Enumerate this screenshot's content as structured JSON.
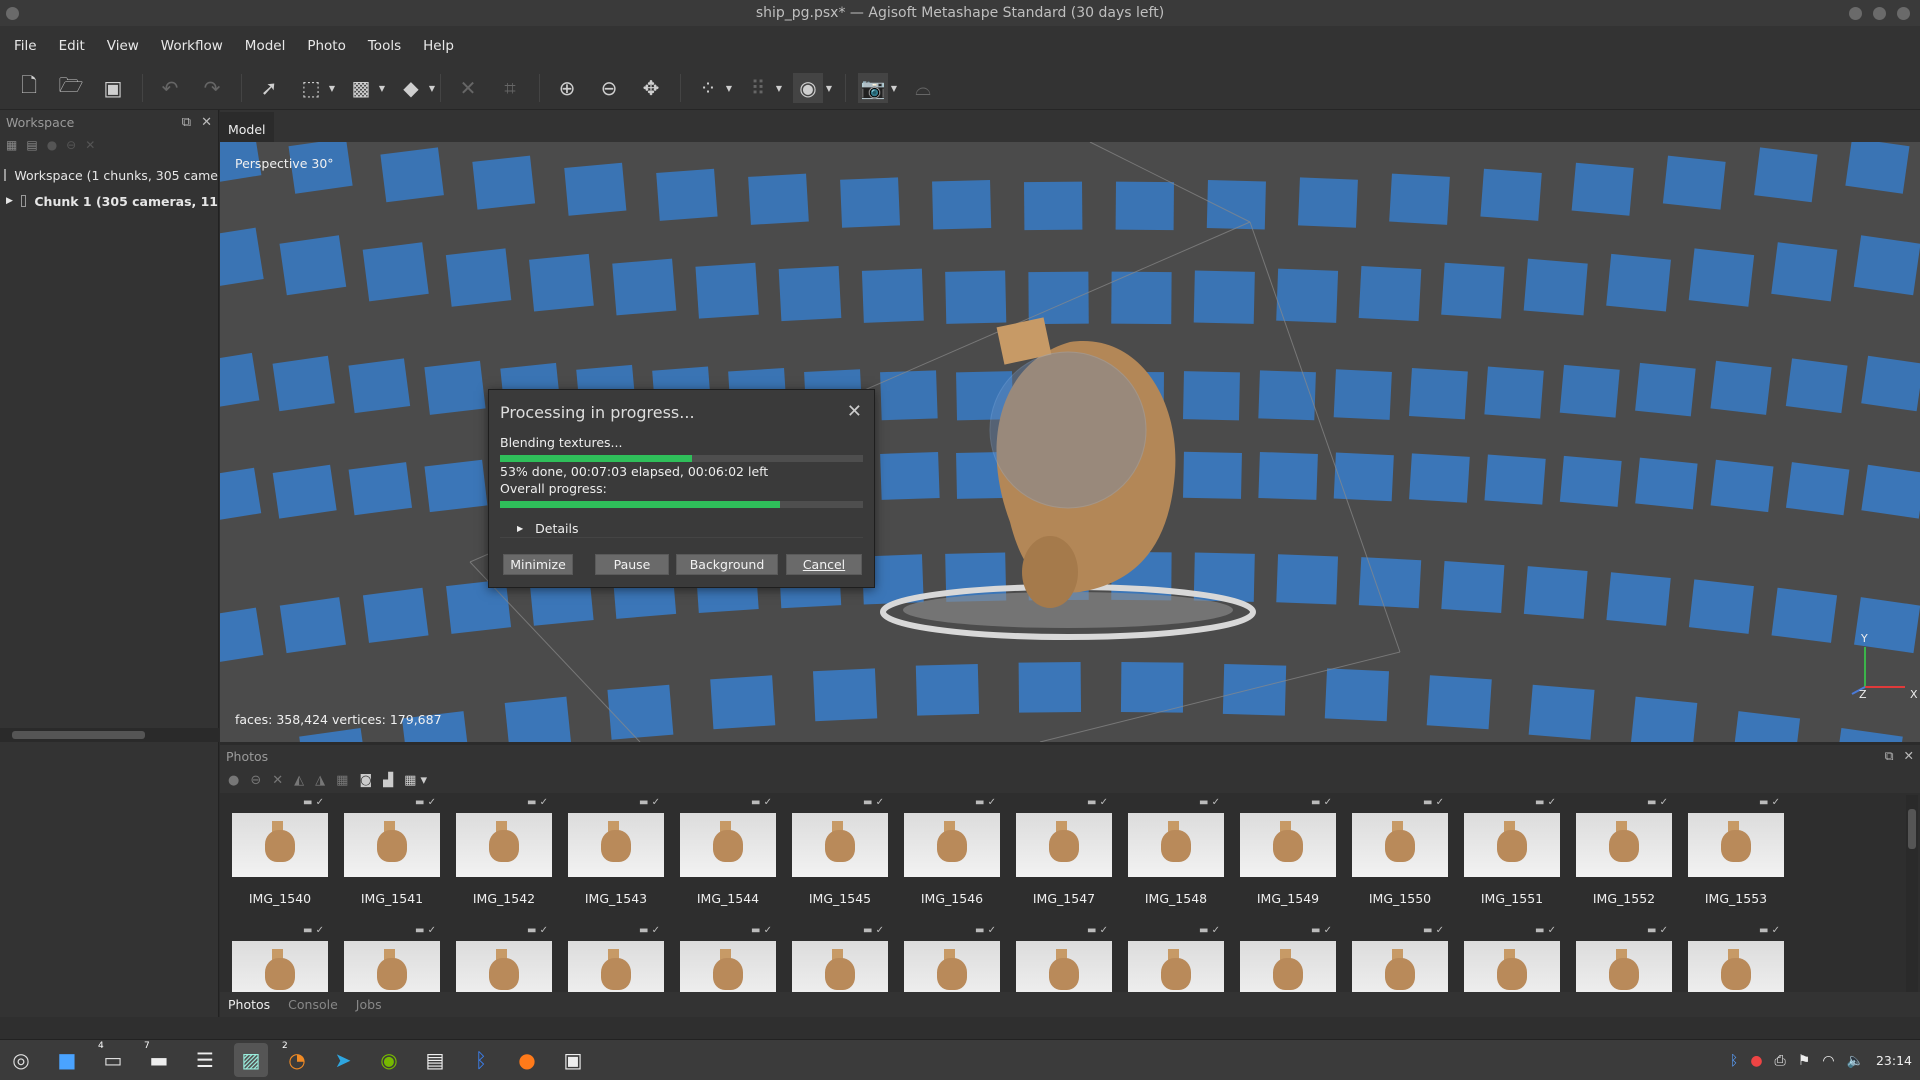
{
  "window": {
    "title": "ship_pg.psx* — Agisoft Metashape Standard (30 days left)"
  },
  "menu": [
    "File",
    "Edit",
    "View",
    "Workflow",
    "Model",
    "Photo",
    "Tools",
    "Help"
  ],
  "toolbar": {
    "icons": [
      "new-file-icon",
      "open-folder-icon",
      "save-icon",
      "undo-icon",
      "redo-icon",
      "select-arrow-icon",
      "rectangle-selection-icon",
      "free-form-selection-icon",
      "resize-region-icon",
      "delete-icon",
      "crop-icon",
      "zoom-in-icon",
      "zoom-out-icon",
      "reset-view-icon",
      "show-points-icon",
      "show-dense-cloud-icon",
      "shading-icon",
      "capture-view-icon",
      "show-cameras-icon"
    ]
  },
  "workspace": {
    "title": "Workspace",
    "items": [
      {
        "label": "Workspace (1 chunks, 305 came"
      },
      {
        "label": "Chunk 1 (305 cameras, 11"
      }
    ]
  },
  "viewport": {
    "tab": "Model",
    "projection": "Perspective 30°",
    "stats": "faces: 358,424 vertices: 179,687",
    "axes": {
      "y": "Y",
      "z": "Z",
      "x": "X"
    }
  },
  "dialog": {
    "title": "Processing in progress...",
    "task": "Blending textures...",
    "task_progress": 0.53,
    "status": "53% done, 00:07:03 elapsed, 00:06:02 left",
    "overall_label": "Overall progress:",
    "overall_progress": 0.77,
    "details": "Details",
    "buttons": {
      "minimize": "Minimize",
      "pause": "Pause",
      "background": "Background",
      "cancel": "Cancel"
    }
  },
  "photos": {
    "title": "Photos",
    "row1": [
      "IMG_1540",
      "IMG_1541",
      "IMG_1542",
      "IMG_1543",
      "IMG_1544",
      "IMG_1545",
      "IMG_1546",
      "IMG_1547",
      "IMG_1548",
      "IMG_1549",
      "IMG_1550",
      "IMG_1551",
      "IMG_1552",
      "IMG_1553"
    ],
    "tabs": [
      "Photos",
      "Console",
      "Jobs"
    ]
  },
  "taskbar": {
    "apps": [
      "app-menu-icon",
      "file-manager-icon",
      "terminal-icon",
      "files-icon",
      "settings-icon",
      "image-viewer-icon",
      "blender-icon",
      "telegram-icon",
      "nvidia-icon",
      "document-icon",
      "bluetooth-icon",
      "firefox-icon",
      "store-icon"
    ],
    "badges": {
      "terminal": "4",
      "files": "7",
      "blender": "2"
    },
    "clock": "23:14"
  }
}
